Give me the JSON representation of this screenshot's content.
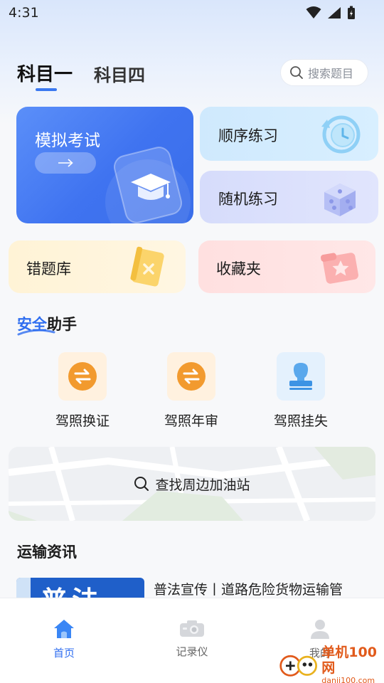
{
  "status_bar": {
    "time": "4:31"
  },
  "header": {
    "tabs": [
      {
        "label": "科目一",
        "active": true
      },
      {
        "label": "科目四",
        "active": false
      }
    ],
    "search": {
      "placeholder": "搜索题目"
    }
  },
  "practice": {
    "exam": {
      "label": "模拟考试"
    },
    "sequential": {
      "label": "顺序练习"
    },
    "random": {
      "label": "随机练习"
    },
    "wrong_bank": {
      "label": "错题库"
    },
    "favorites": {
      "label": "收藏夹"
    }
  },
  "assistant": {
    "title_highlight": "安全",
    "title_rest": "助手",
    "items": [
      {
        "label": "驾照换证",
        "icon": "exchange-icon"
      },
      {
        "label": "驾照年审",
        "icon": "exchange-icon"
      },
      {
        "label": "驾照挂失",
        "icon": "stamp-icon"
      }
    ]
  },
  "map": {
    "search_label": "查找周边加油站"
  },
  "news": {
    "title": "运输资讯",
    "items": [
      {
        "thumb_text": "普法",
        "title": "普法宣传丨道路危险货物运输管"
      }
    ]
  },
  "bottom_nav": [
    {
      "label": "首页",
      "icon": "home-icon",
      "active": true
    },
    {
      "label": "记录仪",
      "icon": "camera-icon",
      "active": false
    },
    {
      "label": "我的",
      "icon": "user-icon",
      "active": false
    }
  ],
  "watermark": {
    "main": "单机100网",
    "sub": "danji100.com"
  },
  "colors": {
    "accent": "#2f6ef0",
    "orange": "#f29a2e"
  }
}
